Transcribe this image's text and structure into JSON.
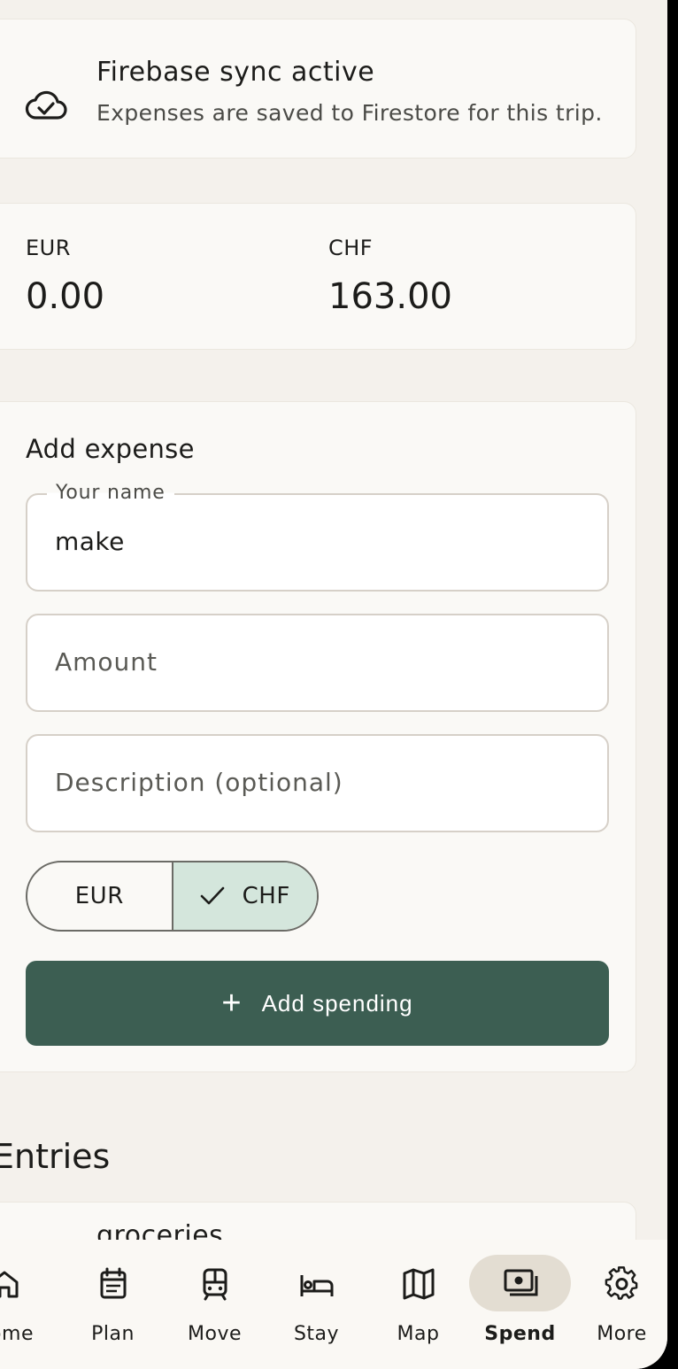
{
  "sync": {
    "title": "Firebase sync active",
    "subtitle": "Expenses are saved to Firestore for this trip.",
    "icon": "cloud-check-icon"
  },
  "totals": [
    {
      "currency": "EUR",
      "value": "0.00"
    },
    {
      "currency": "CHF",
      "value": "163.00"
    }
  ],
  "form": {
    "title": "Add expense",
    "name_label": "Your name",
    "name_value": "make",
    "amount_placeholder": "Amount",
    "description_placeholder": "Description (optional)",
    "currency_options": [
      "EUR",
      "CHF"
    ],
    "selected_currency": "CHF",
    "submit_label": "Add spending"
  },
  "entries": {
    "title": "Entries",
    "items": [
      {
        "description": "groceries"
      }
    ]
  },
  "nav": {
    "active": "Spend",
    "items": [
      {
        "label": "Home",
        "icon": "home-icon"
      },
      {
        "label": "Plan",
        "icon": "calendar-icon"
      },
      {
        "label": "Move",
        "icon": "train-icon"
      },
      {
        "label": "Stay",
        "icon": "bed-icon"
      },
      {
        "label": "Map",
        "icon": "map-icon"
      },
      {
        "label": "Spend",
        "icon": "money-icon"
      },
      {
        "label": "More",
        "icon": "gear-icon"
      }
    ]
  },
  "colors": {
    "accent": "#3c5e52",
    "selected_segment": "#d4e6dc",
    "background": "#f4f1ec",
    "nav_pill": "#e3ddd2"
  }
}
